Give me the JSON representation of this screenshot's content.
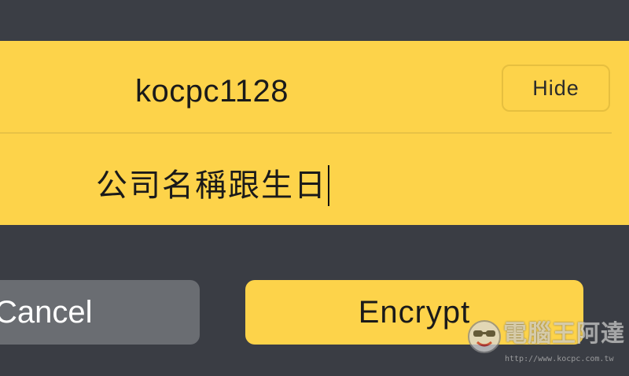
{
  "colors": {
    "background": "#3a3d44",
    "panel": "#fdd34a",
    "accent_button": "#fdd34a",
    "secondary_button": "#6a6d72",
    "text_dark": "#1a1a1a",
    "text_light": "#ffffff"
  },
  "form": {
    "password": {
      "value": "kocpc1128",
      "toggle_label": "Hide"
    },
    "hint": {
      "value": "公司名稱跟生日"
    }
  },
  "actions": {
    "cancel_label": "Cancel",
    "encrypt_label": "Encrypt"
  },
  "watermark": {
    "title": "電腦王阿達",
    "url": "http://www.kocpc.com.tw",
    "icon": "mascot-face-icon"
  }
}
